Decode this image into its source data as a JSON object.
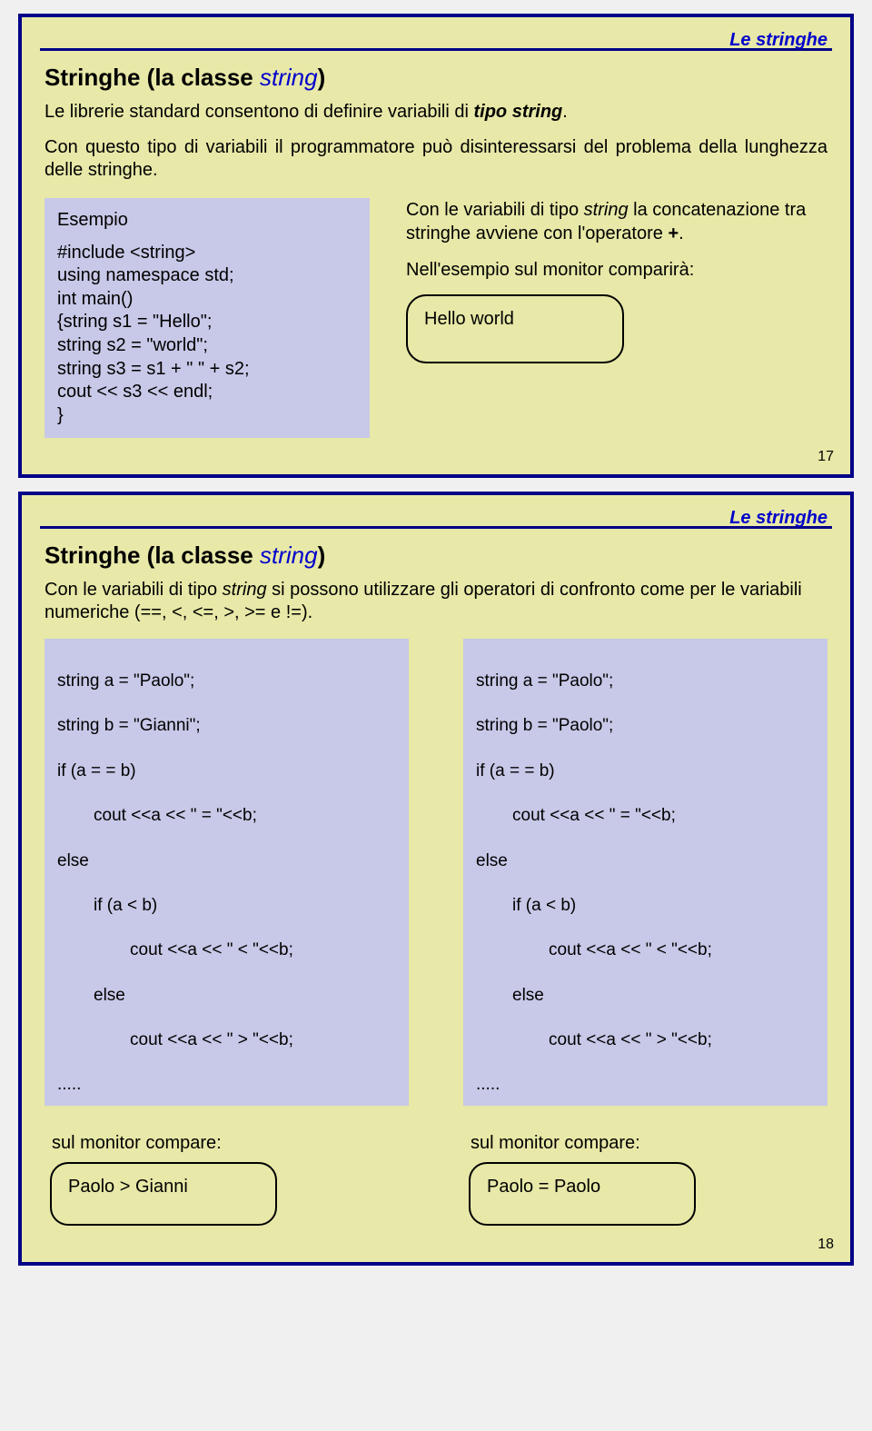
{
  "slide17": {
    "pageNum": "17",
    "cornerTag": "Le stringhe",
    "title_pre": "Stringhe (la classe ",
    "title_em": "string",
    "title_post": ")",
    "intro1_pre": "Le librerie standard consentono di definire variabili  di ",
    "intro1_bold": "tipo string",
    "intro1_post": ".",
    "intro2": "Con questo tipo di variabili il programmatore può disinteressarsi del problema della lunghezza delle stringhe.",
    "example_label": "Esempio",
    "code_l1": "#include <string>",
    "code_l2": "using namespace std;",
    "code_l3": "int main()",
    "code_l4": "{string s1 = \"Hello\";",
    "code_l5": " string s2 = \"world\";",
    "code_l6": " string s3 = s1 + \" \" + s2;",
    "code_l7": " cout << s3 << endl;",
    "code_l8": "}",
    "right1_a": "Con le variabili di tipo ",
    "right1_b": "string",
    "right1_c": " la concatenazione tra stringhe avviene con l'operatore ",
    "right1_d": "+",
    "right1_e": ".",
    "right2": "Nell'esempio sul monitor comparirà:",
    "output": "Hello world"
  },
  "slide18": {
    "pageNum": "18",
    "cornerTag": "Le stringhe",
    "title_pre": "Stringhe (la classe ",
    "title_em": "string",
    "title_post": ")",
    "intro_a": "Con le variabili di tipo ",
    "intro_b": "string",
    "intro_c": " si possono utilizzare gli operatori di confronto come per le variabili numeriche (==,  <, <=, >, >=  e !=).",
    "left_l1": "string a = \"Paolo\";",
    "left_l2": "string b = \"Gianni\";",
    "left_l3": "if (a = = b)",
    "left_l4": "cout <<a << \" = \"<<b;",
    "left_l5": "else",
    "left_l6": "if (a < b)",
    "left_l7": "cout <<a << \" < \"<<b;",
    "left_l8": "else",
    "left_l9": "cout <<a << \" > \"<<b;",
    "left_l10": ".....",
    "right_l1": "string a = \"Paolo\";",
    "right_l2": "string b = \"Paolo\";",
    "right_l3": "if (a = = b)",
    "right_l4": "cout <<a << \" = \"<<b;",
    "right_l5": "else",
    "right_l6": "if (a < b)",
    "right_l7": "cout <<a << \" < \"<<b;",
    "right_l8": "else",
    "right_l9": "cout <<a << \" > \"<<b;",
    "right_l10": ".....",
    "monitor_label": "sul monitor compare:",
    "out_left": "Paolo  >  Gianni",
    "out_right": "Paolo  =  Paolo"
  }
}
